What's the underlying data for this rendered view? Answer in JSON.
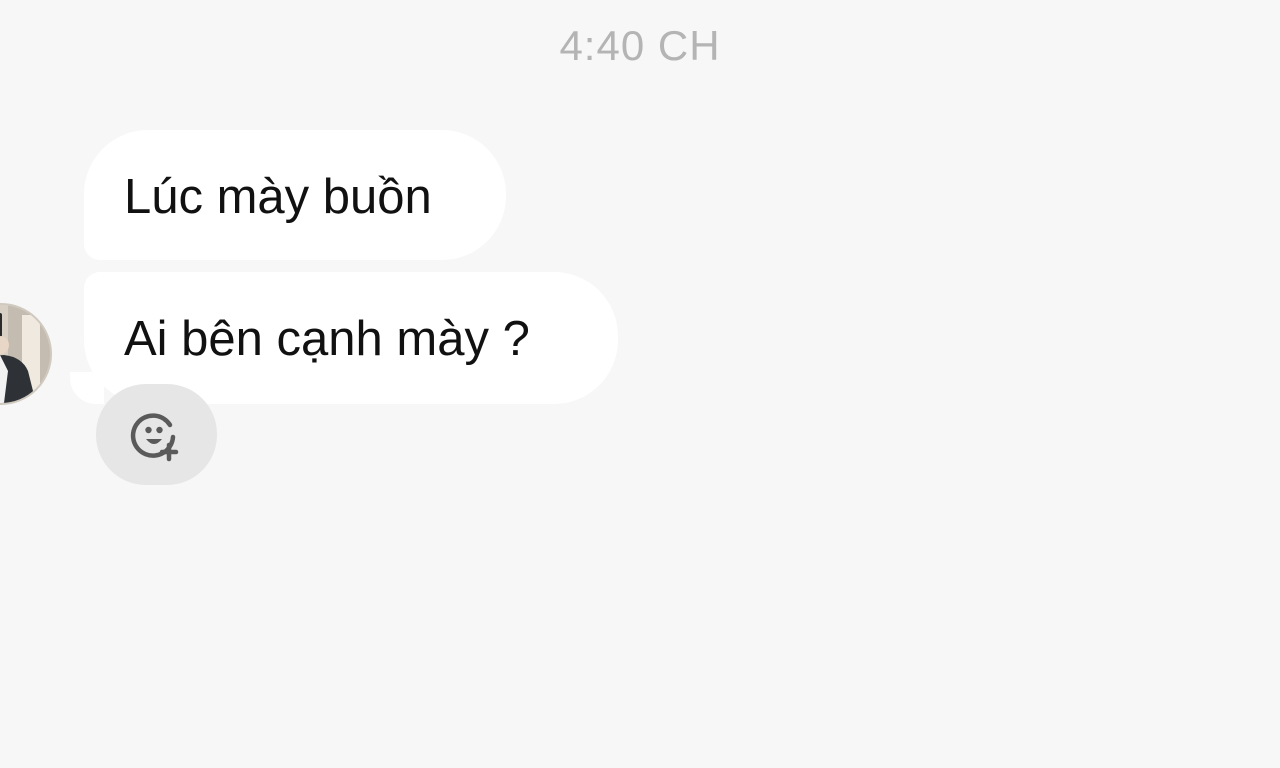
{
  "conversation": {
    "timestamp": "4:40 CH",
    "messages": [
      {
        "text": "Lúc mày buồn"
      },
      {
        "text": "Ai bên cạnh mày ?"
      }
    ],
    "avatar_icon": "user-photo-avatar",
    "reaction_icon": "add-reaction-icon"
  },
  "colors": {
    "background": "#f7f7f7",
    "bubble": "#ffffff",
    "text": "#111111",
    "timestamp": "#b4b4b4",
    "reaction_button": "#e6e6e6",
    "icon": "#5a5a5a"
  }
}
